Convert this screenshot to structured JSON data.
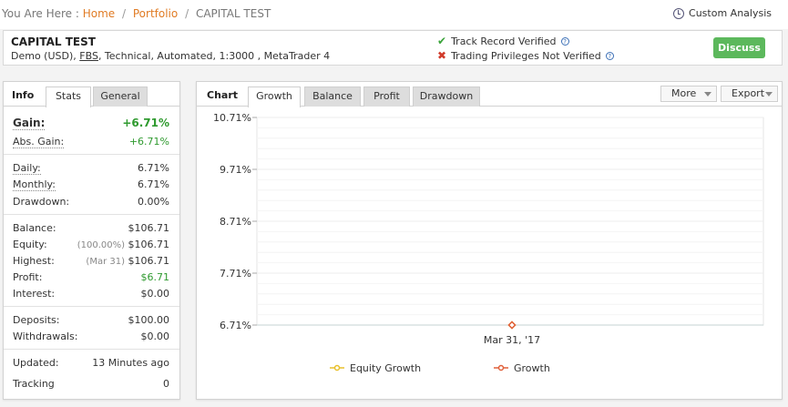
{
  "breadcrumb": {
    "prefix": "You Are Here :",
    "home": "Home",
    "portfolio": "Portfolio",
    "current": "CAPITAL TEST",
    "separator": "/"
  },
  "custom_analysis": "Custom Analysis",
  "system": {
    "name": "CAPITAL TEST",
    "desc_before": "Demo (USD),",
    "broker": "FBS",
    "desc_after": ", Technical, Automated, 1:3000 , MetaTrader 4",
    "track_record": "Track Record Verified",
    "trading_privileges": "Trading Privileges Not Verified",
    "help_glyph": "?",
    "discuss_label": "Discuss"
  },
  "info_panel": {
    "title": "Info",
    "tabs": [
      "Stats",
      "General"
    ],
    "gain_label": "Gain:",
    "gain_value": "+6.71%",
    "abs_gain_label": "Abs. Gain:",
    "abs_gain_value": "+6.71%",
    "daily_label": "Daily:",
    "daily_value": "6.71%",
    "monthly_label": "Monthly:",
    "monthly_value": "6.71%",
    "drawdown_label": "Drawdown:",
    "drawdown_value": "0.00%",
    "balance_label": "Balance:",
    "balance_value": "$106.71",
    "equity_label": "Equity:",
    "equity_note": "(100.00%)",
    "equity_value": "$106.71",
    "highest_label": "Highest:",
    "highest_note": "(Mar 31)",
    "highest_value": "$106.71",
    "profit_label": "Profit:",
    "profit_value": "$6.71",
    "interest_label": "Interest:",
    "interest_value": "$0.00",
    "deposits_label": "Deposits:",
    "deposits_value": "$100.00",
    "withdrawals_label": "Withdrawals:",
    "withdrawals_value": "$0.00",
    "updated_label": "Updated:",
    "updated_value": "13 Minutes ago",
    "tracking_label": "Tracking",
    "tracking_value": "0"
  },
  "chart_panel": {
    "title": "Chart",
    "tabs": [
      "Growth",
      "Balance",
      "Profit",
      "Drawdown"
    ],
    "active_tab": "Growth",
    "more_label": "More",
    "export_label": "Export"
  },
  "colors": {
    "accent_orange": "#e07b24",
    "gain_green": "#2f9a2f",
    "discuss_green": "#5cb85c",
    "equity_series": "#e8c02a",
    "growth_series": "#e0603a"
  },
  "chart_data": {
    "type": "line",
    "y_ticks": [
      "10.71%",
      "9.71%",
      "8.71%",
      "7.71%",
      "6.71%"
    ],
    "ylim": [
      6.71,
      10.71
    ],
    "x_ticks": [
      "Mar 31, '17"
    ],
    "series": [
      {
        "name": "Equity Growth",
        "x": [
          "Mar 31, '17"
        ],
        "values": [
          6.71
        ]
      },
      {
        "name": "Growth",
        "x": [
          "Mar 31, '17"
        ],
        "values": [
          6.71
        ]
      }
    ],
    "legend_position": "bottom"
  }
}
